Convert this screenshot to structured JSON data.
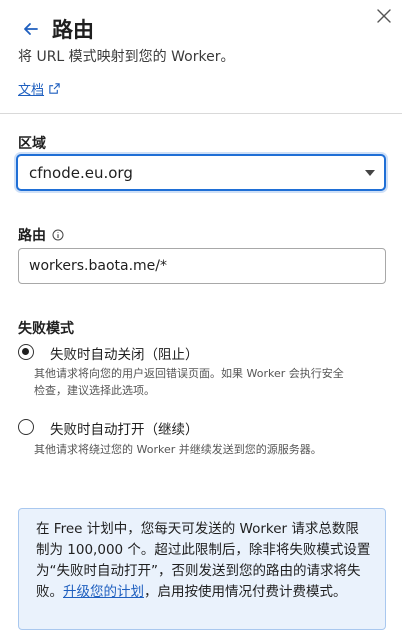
{
  "header": {
    "title": "路由",
    "subtitle": "将 URL 模式映射到您的 Worker。",
    "docs_link": "文档"
  },
  "region": {
    "label": "区域",
    "selected": "cfnode.eu.org"
  },
  "route": {
    "label": "路由",
    "value": "workers.baota.me/*"
  },
  "failure_mode": {
    "label": "失败模式",
    "options": [
      {
        "label": "失败时自动关闭（阻止）",
        "description": "其他请求将向您的用户返回错误页面。如果 Worker 会执行安全检查，建议选择此选项。",
        "checked": true
      },
      {
        "label": "失败时自动打开（继续）",
        "description": "其他请求将绕过您的 Worker 并继续发送到您的源服务器。",
        "checked": false
      }
    ]
  },
  "notice": {
    "text_before": "在 Free 计划中，您每天可发送的 Worker 请求总数限制为 100,000 个。超过此限制后，除非将失败模式设置为“失败时自动打开”，否则发送到您的路由的请求将失败。",
    "link": "升级您的计划",
    "text_after": "，启用按使用情况付费计费模式。"
  },
  "colors": {
    "accent": "#1f6fd6",
    "link": "#1e5fbf",
    "notice_bg": "#eaf2fc"
  }
}
